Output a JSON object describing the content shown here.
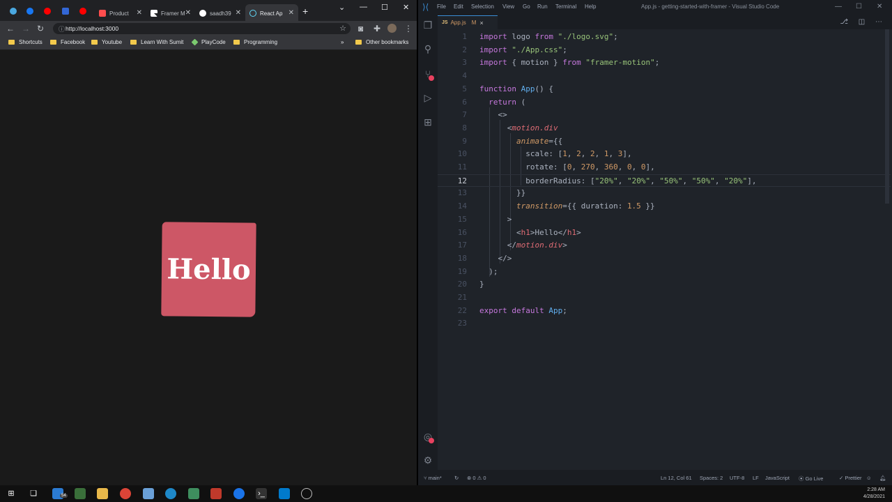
{
  "chrome": {
    "tabs": [
      {
        "label": "Product",
        "color": "#ff4d4d",
        "active": false
      },
      {
        "label": "Framer M",
        "color": "#ffffff",
        "active": false
      },
      {
        "label": "saadh39",
        "color": "#ffffff",
        "active": false
      },
      {
        "label": "React Ap",
        "color": "#61dafb",
        "active": true
      }
    ],
    "url": "http://localhost:3000",
    "bookmarks": [
      {
        "label": "Shortcuts"
      },
      {
        "label": "Facebook"
      },
      {
        "label": "Youtube"
      },
      {
        "label": "Learn With Sumit"
      },
      {
        "label": "PlayCode"
      },
      {
        "label": "Programming"
      }
    ],
    "other_bookmarks": "Other bookmarks",
    "overflow_glyph": "»",
    "page": {
      "heading": "Hello",
      "box_color": "#cd5766",
      "background": "#1a1a1a"
    }
  },
  "vscode": {
    "menu": [
      "File",
      "Edit",
      "Selection",
      "View",
      "Go",
      "Run",
      "Terminal",
      "Help"
    ],
    "caption": "App.js - getting-started-with-framer - Visual Studio Code",
    "tab": {
      "icon_text": "JS",
      "label": "App.js",
      "modified": "M",
      "close": "×"
    },
    "status": {
      "branch": "main*",
      "problems": "⊗ 0 ⚠ 0",
      "cursor": "Ln 12, Col 61",
      "spaces": "Spaces: 2",
      "encoding": "UTF-8",
      "eol": "LF",
      "language": "JavaScript",
      "live": "Go Live",
      "prettier": "Prettier"
    },
    "line_numbers": [
      "1",
      "2",
      "3",
      "4",
      "5",
      "6",
      "7",
      "8",
      "9",
      "10",
      "11",
      "12",
      "13",
      "14",
      "15",
      "16",
      "17",
      "18",
      "19",
      "20",
      "21",
      "22",
      "23"
    ],
    "current_line": "12"
  },
  "taskbar": {
    "time": "2:28 AM",
    "date": "4/28/2021",
    "badge_count": "54"
  }
}
